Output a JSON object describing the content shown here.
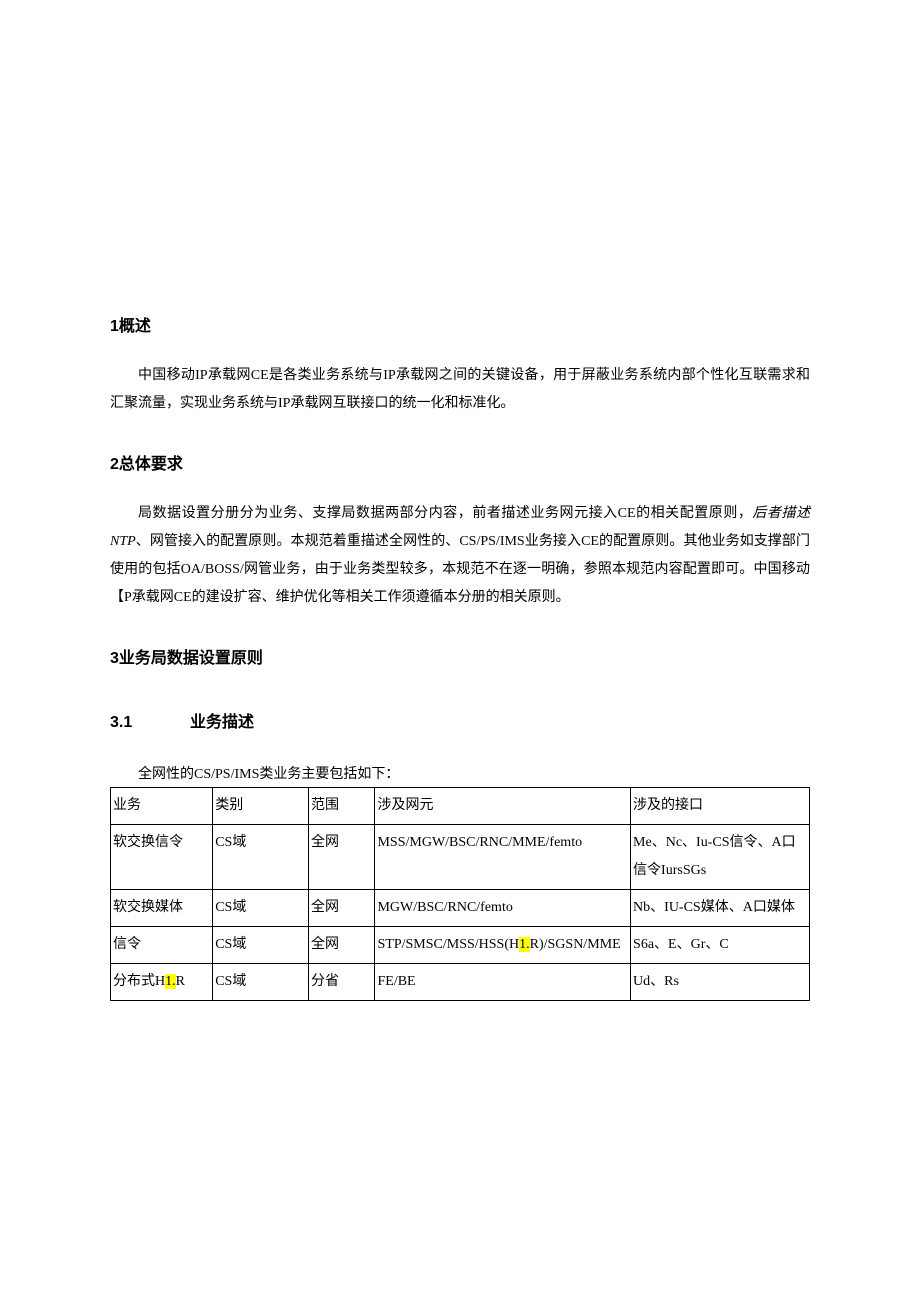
{
  "h1": "1概述",
  "p1_a": "中国移动IP承载网CE是各类业务系统与IP承载网之间的关键设备，用于屏蔽业务系统内部个性化互联需求和汇聚流量，实现业务系统与IP承载网互联接口的统一化和标准化。",
  "h2": "2总体要求",
  "p2_pre": "局数据设置分册分为业务、支撑局数据两部分内容，前者描述业务网元接入CE的相关配置原则，",
  "p2_italic": "后者描述NTP",
  "p2_mid": "、网管接入的配置原则。本规范着重描述全网性的、CS/PS/IMS业务接入CE的配置原则。其他业务如支撑部门使用的包括OA/BOSS/网管业务，由于业务类型较多，本规范不在逐一明确，参照本规范内容配置即可。中国移动",
  "p2_bracket": "【",
  "p2_post": "P承载网CE的建设扩容、维护优化等相关工作须遵循本分册的相关原则。",
  "h3": "3业务局数据设置原则",
  "h3_1_num": "3.1",
  "h3_1_text": "业务描述",
  "caption": "全网性的CS/PS/IMS类业务主要包括如下：",
  "chart_data": {
    "type": "table",
    "headers": [
      "业务",
      "类别",
      "范围",
      "涉及网元",
      "涉及的接口"
    ],
    "rows": [
      {
        "biz": "软交换信令",
        "cat": "CS域",
        "scope": "全网",
        "elem": "MSS/MGW/BSC/RNC/MME/femto",
        "intf": "Me、Nc、Iu-CS信令、A口信令IursSGs"
      },
      {
        "biz": "软交换媒体",
        "cat": "CS域",
        "scope": "全网",
        "elem": "MGW/BSC/RNC/femto",
        "intf": "Nb、IU-CS媒体、A口媒体"
      },
      {
        "biz": "信令",
        "cat": "CS域",
        "scope": "全网",
        "elem_pre": "STP/SMSC/MSS/HSS(H",
        "elem_hl": "1.",
        "elem_post": "R)/SGSN/MME",
        "intf": "S6a、E、Gr、C"
      },
      {
        "biz_pre": "分布式H",
        "biz_hl": "1.",
        "biz_post": "R",
        "cat": "CS域",
        "scope": "分省",
        "elem": "FE/BE",
        "intf": "Ud、Rs"
      }
    ]
  }
}
